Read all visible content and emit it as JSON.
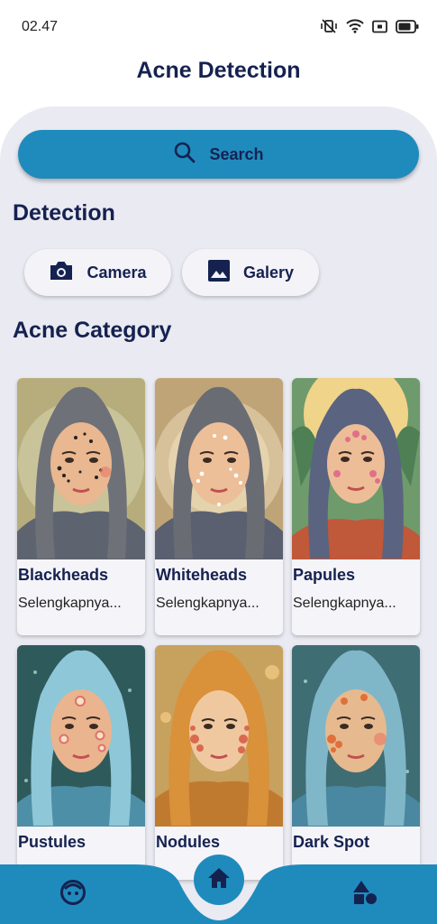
{
  "status_bar": {
    "time": "02.47",
    "icons": [
      "vibrate-mute-icon",
      "wifi-icon",
      "cast-icon",
      "battery-icon"
    ]
  },
  "app": {
    "title": "Acne Detection"
  },
  "search": {
    "label": "Search",
    "icon": "search-icon"
  },
  "detection": {
    "title": "Detection",
    "buttons": [
      {
        "label": "Camera",
        "icon": "camera-icon"
      },
      {
        "label": "Galery",
        "icon": "image-icon"
      }
    ]
  },
  "category": {
    "title": "Acne Category",
    "cards": [
      {
        "title": "Blackheads",
        "desc": "Selengkapnya..."
      },
      {
        "title": "Whiteheads",
        "desc": "Selengkapnya..."
      },
      {
        "title": "Papules",
        "desc": "Selengkapnya..."
      },
      {
        "title": "Pustules"
      },
      {
        "title": "Nodules"
      },
      {
        "title": "Dark Spot"
      }
    ]
  },
  "bottom_nav": {
    "items": [
      {
        "icon": "face-icon",
        "active": false
      },
      {
        "icon": "home-icon",
        "active": true
      },
      {
        "icon": "shapes-icon",
        "active": false
      }
    ]
  },
  "colors": {
    "primary": "#1f8bbd",
    "text_dark": "#152250",
    "panel_bg": "#eaeaf2",
    "card_bg": "#f5f4f9"
  }
}
